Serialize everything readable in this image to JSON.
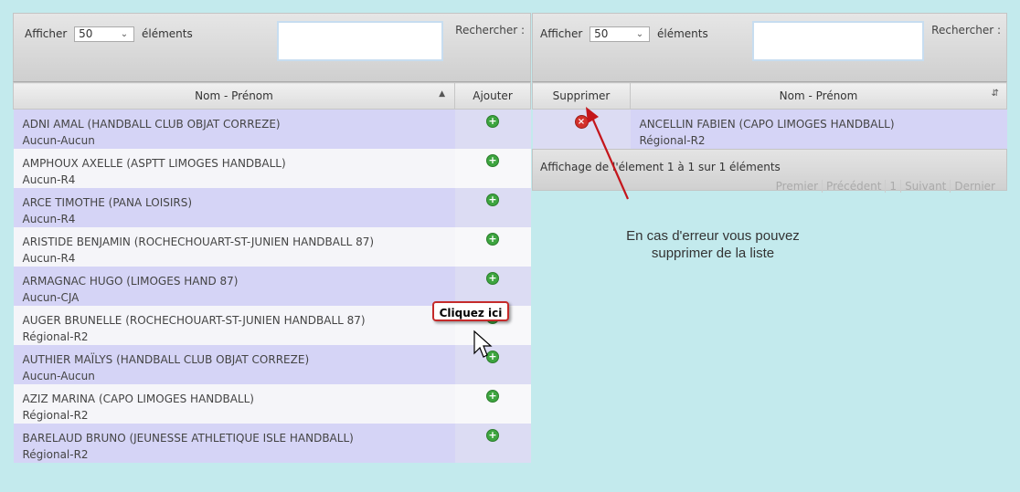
{
  "left": {
    "show_label": "Afficher",
    "show_value": "50",
    "show_suffix": "éléments",
    "search_label": "Rechercher :",
    "col_name": "Nom - Prénom",
    "col_add": "Ajouter",
    "rows": [
      {
        "name": "ADNI AMAL (HANDBALL CLUB OBJAT CORREZE)",
        "level": "Aucun-Aucun"
      },
      {
        "name": "AMPHOUX AXELLE (ASPTT LIMOGES HANDBALL)",
        "level": "Aucun-R4"
      },
      {
        "name": "ARCE TIMOTHE (PANA LOISIRS)",
        "level": "Aucun-R4"
      },
      {
        "name": "ARISTIDE BENJAMIN (ROCHECHOUART-ST-JUNIEN HANDBALL 87)",
        "level": "Aucun-R4"
      },
      {
        "name": "ARMAGNAC HUGO (LIMOGES HAND 87)",
        "level": "Aucun-CJA"
      },
      {
        "name": "AUGER BRUNELLE (ROCHECHOUART-ST-JUNIEN HANDBALL 87)",
        "level": "Régional-R2"
      },
      {
        "name": "AUTHIER MAÏLYS (HANDBALL CLUB OBJAT CORREZE)",
        "level": "Aucun-Aucun"
      },
      {
        "name": "AZIZ MARINA (CAPO LIMOGES HANDBALL)",
        "level": "Régional-R2"
      },
      {
        "name": "BARELAUD BRUNO (JEUNESSE ATHLETIQUE ISLE HANDBALL)",
        "level": "Régional-R2"
      }
    ]
  },
  "right": {
    "show_label": "Afficher",
    "show_value": "50",
    "show_suffix": "éléments",
    "search_label": "Rechercher :",
    "col_delete": "Supprimer",
    "col_name": "Nom - Prénom",
    "rows": [
      {
        "name": "ANCELLIN FABIEN (CAPO LIMOGES HANDBALL)",
        "level": "Régional-R2"
      }
    ],
    "info": "Affichage de l'élement 1 à 1 sur 1 éléments",
    "pager": {
      "first": "Premier",
      "prev": "Précédent",
      "page": "1",
      "next": "Suivant",
      "last": "Dernier"
    }
  },
  "annotations": {
    "callout": "Cliquez ici",
    "note_line1": "En cas d'erreur vous pouvez",
    "note_line2": "supprimer de la liste",
    "arrow_color": "#c4161c"
  },
  "icons": {
    "add": "plus-circle-icon",
    "delete": "x-circle-icon",
    "cursor": "mouse-pointer-icon"
  }
}
